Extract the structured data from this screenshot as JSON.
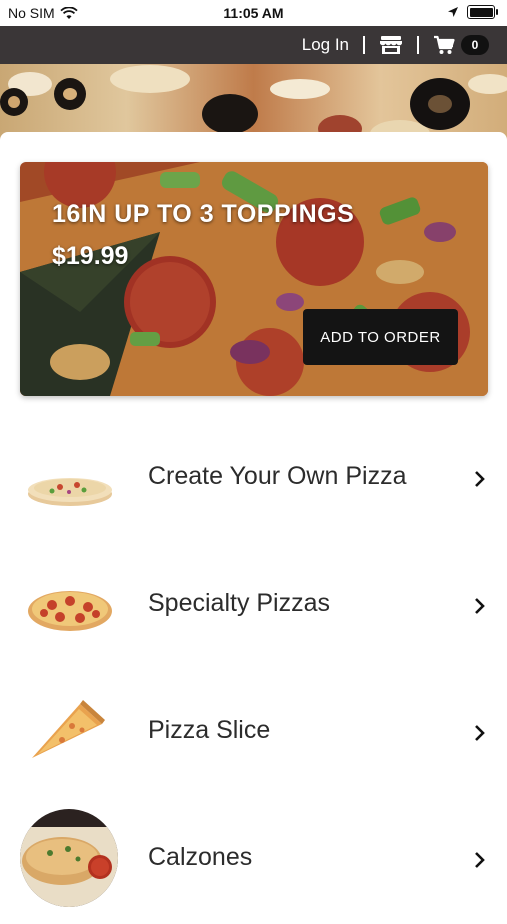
{
  "status_bar": {
    "carrier": "No SIM",
    "time": "11:05 AM"
  },
  "nav": {
    "login_label": "Log In",
    "cart_count": "0"
  },
  "promo": {
    "title": "16IN UP TO 3 TOPPINGS",
    "price": "$19.99",
    "button_label": "ADD TO ORDER"
  },
  "menu": {
    "items": [
      {
        "label": "Create Your Own Pizza",
        "icon": "whole-pizza-image"
      },
      {
        "label": "Specialty Pizzas",
        "icon": "pepperoni-pizza-image"
      },
      {
        "label": "Pizza Slice",
        "icon": "pizza-slice-image"
      },
      {
        "label": "Calzones",
        "icon": "calzone-image"
      }
    ]
  },
  "colors": {
    "nav_bg": "#3a3637",
    "button_bg": "#141414",
    "text": "#2c2c2c"
  }
}
